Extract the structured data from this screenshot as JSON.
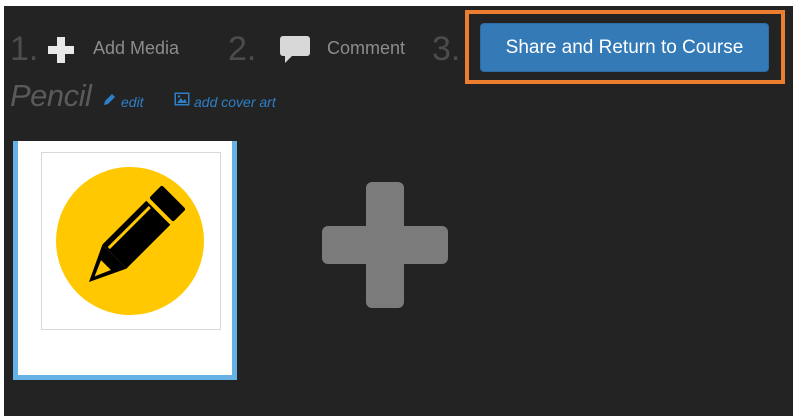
{
  "steps": [
    {
      "number": "1.",
      "label": "Add Media",
      "icon": "plus-icon"
    },
    {
      "number": "2.",
      "label": "Comment",
      "icon": "comment-icon"
    },
    {
      "number": "3.",
      "label": "",
      "icon": ""
    }
  ],
  "share_button": {
    "label": "Share and Return to Course",
    "highlight_color": "#ee7e2f"
  },
  "item": {
    "title": "Pencil",
    "edit_label": "edit",
    "cover_art_label": "add cover art"
  },
  "media": {
    "thumbnail_icon": "pencil-icon",
    "add_icon": "add-media-plus-icon"
  },
  "colors": {
    "background": "#232323",
    "accent": "#337ab7",
    "link": "#2f7fc8",
    "selected_border": "#67b2e4",
    "pencil_circle": "#ffc800"
  }
}
